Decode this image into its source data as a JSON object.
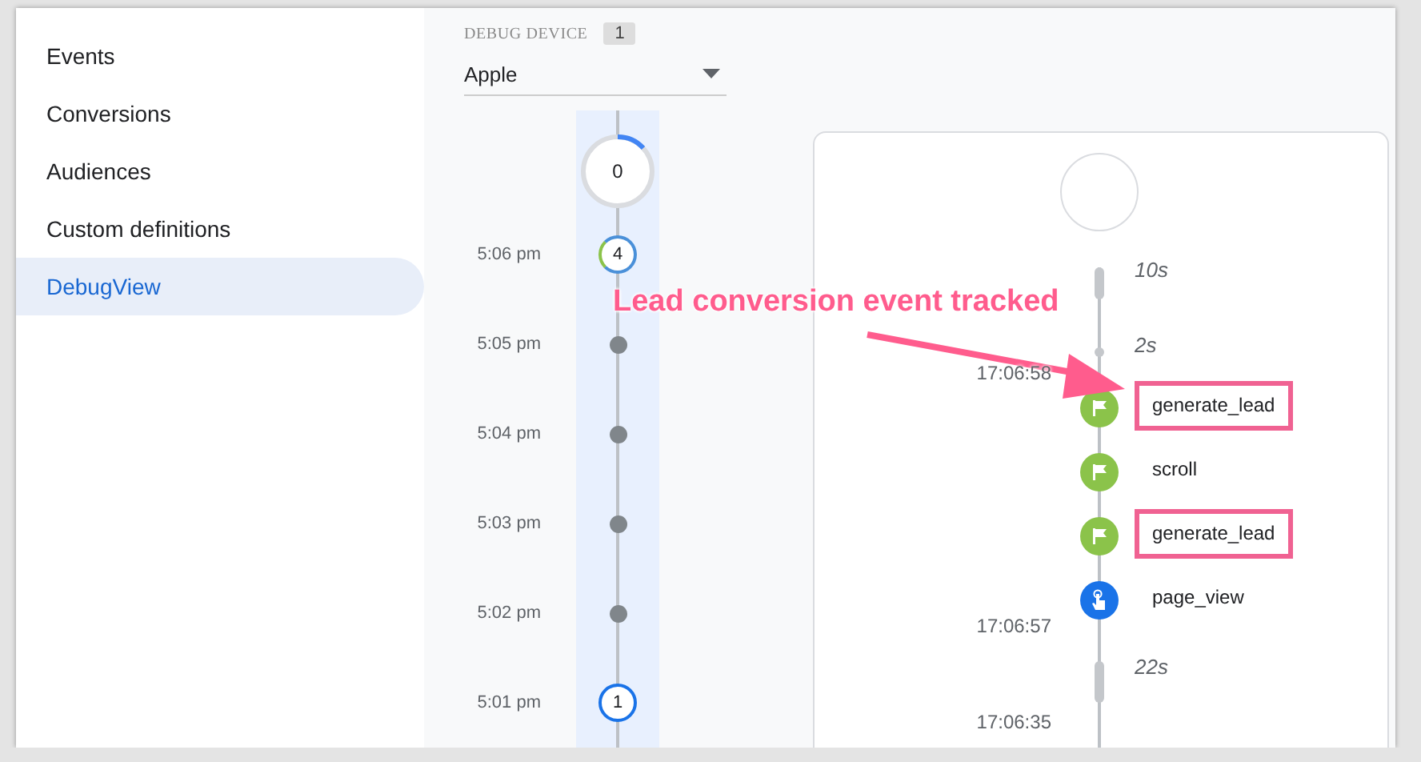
{
  "sidebar": {
    "items": [
      {
        "label": "Events",
        "selected": false
      },
      {
        "label": "Conversions",
        "selected": false
      },
      {
        "label": "Audiences",
        "selected": false
      },
      {
        "label": "Custom definitions",
        "selected": false
      },
      {
        "label": "DebugView",
        "selected": true
      }
    ]
  },
  "debug_device": {
    "label": "DEBUG DEVICE",
    "count": "1",
    "value": "Apple"
  },
  "minutes": {
    "top_count": "0",
    "rows": [
      {
        "time": "5:06 pm",
        "kind": "count",
        "count": "4"
      },
      {
        "time": "5:05 pm",
        "kind": "dot"
      },
      {
        "time": "5:04 pm",
        "kind": "dot"
      },
      {
        "time": "5:03 pm",
        "kind": "dot"
      },
      {
        "time": "5:02 pm",
        "kind": "dot"
      },
      {
        "time": "5:01 pm",
        "kind": "count",
        "count": "1"
      }
    ]
  },
  "seconds": {
    "gaps": [
      "10s",
      "2s",
      "22s"
    ],
    "times": [
      "17:06:58",
      "17:06:57",
      "17:06:35"
    ],
    "events": [
      {
        "name": "generate_lead",
        "kind": "flag",
        "highlighted": true
      },
      {
        "name": "scroll",
        "kind": "flag",
        "highlighted": false
      },
      {
        "name": "generate_lead",
        "kind": "flag",
        "highlighted": true
      },
      {
        "name": "page_view",
        "kind": "touch",
        "highlighted": false
      }
    ]
  },
  "annotation": {
    "text": "Lead conversion event tracked"
  }
}
